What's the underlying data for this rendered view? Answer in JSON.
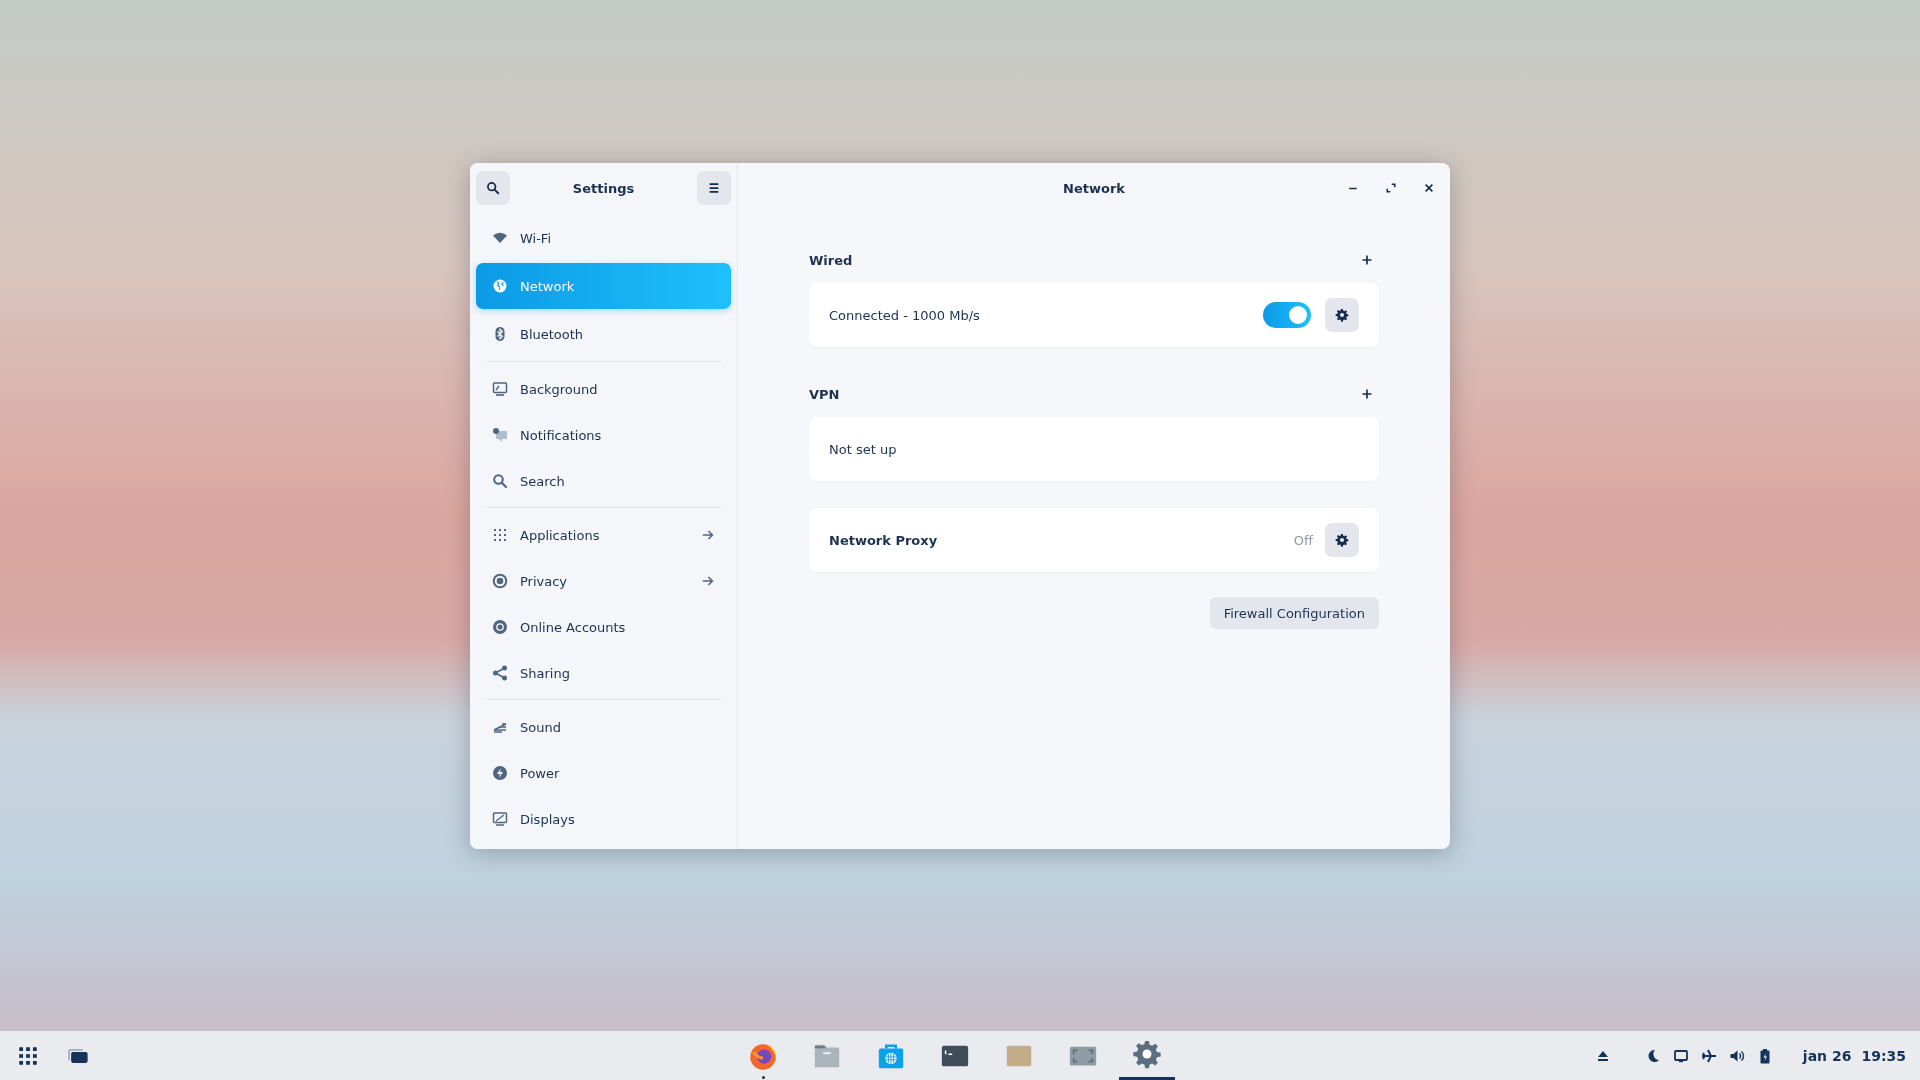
{
  "window": {
    "sidebar_title": "Settings",
    "title": "Network"
  },
  "sidebar": {
    "groups": [
      {
        "items": [
          {
            "label": "Wi-Fi",
            "selected": false,
            "arrow": false
          },
          {
            "label": "Network",
            "selected": true,
            "arrow": false
          },
          {
            "label": "Bluetooth",
            "selected": false,
            "arrow": false
          }
        ]
      },
      {
        "items": [
          {
            "label": "Background",
            "selected": false,
            "arrow": false
          },
          {
            "label": "Notifications",
            "selected": false,
            "arrow": false
          },
          {
            "label": "Search",
            "selected": false,
            "arrow": false
          }
        ]
      },
      {
        "items": [
          {
            "label": "Applications",
            "selected": false,
            "arrow": true
          },
          {
            "label": "Privacy",
            "selected": false,
            "arrow": true
          },
          {
            "label": "Online Accounts",
            "selected": false,
            "arrow": false
          },
          {
            "label": "Sharing",
            "selected": false,
            "arrow": false
          }
        ]
      },
      {
        "items": [
          {
            "label": "Sound",
            "selected": false,
            "arrow": false
          },
          {
            "label": "Power",
            "selected": false,
            "arrow": false
          },
          {
            "label": "Displays",
            "selected": false,
            "arrow": false
          }
        ]
      }
    ]
  },
  "sections": [
    {
      "heading": "Wired",
      "rows": [
        {
          "kind": "toggle",
          "label": "Connected - 1000 Mb/s",
          "on": true
        }
      ]
    },
    {
      "heading": "VPN",
      "rows": [
        {
          "kind": "text",
          "label": "Not set up"
        }
      ]
    },
    {
      "rows": [
        {
          "kind": "setting",
          "label": "Network Proxy",
          "value": "Off"
        }
      ]
    }
  ],
  "firewall_button": "Firewall Configuration",
  "taskbar": {
    "apps": [
      {
        "running": true,
        "focused": false
      },
      {
        "running": false,
        "focused": false
      },
      {
        "running": false,
        "focused": false
      },
      {
        "running": false,
        "focused": false
      },
      {
        "running": false,
        "focused": false
      },
      {
        "running": false,
        "focused": false
      },
      {
        "running": false,
        "focused": true
      }
    ],
    "clock": {
      "date": "jan 26",
      "time": "19:35"
    }
  }
}
